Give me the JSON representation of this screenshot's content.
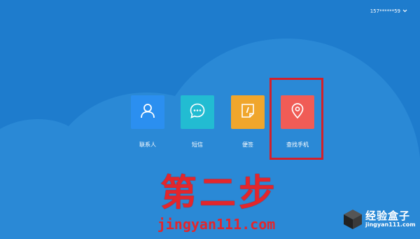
{
  "account": {
    "label": "157******59",
    "dropdown_icon": "chevron-down-icon"
  },
  "apps": [
    {
      "label": "联系人",
      "icon": "user-icon",
      "color": "#2b8ff0"
    },
    {
      "label": "短信",
      "icon": "chat-bubble-icon",
      "color": "#22bcd2"
    },
    {
      "label": "便签",
      "icon": "note-icon",
      "color": "#f0a62c"
    },
    {
      "label": "查找手机",
      "icon": "location-pin-icon",
      "color": "#f05c56"
    }
  ],
  "annotation": {
    "step_text": "第二步",
    "site_text": "jingyan111.com",
    "highlight_color": "#d3202a"
  },
  "watermark": {
    "title": "经验盒子",
    "url": "jingyan111.com"
  },
  "colors": {
    "background": "#1e7ccd",
    "cloud": "#2a89d6"
  }
}
